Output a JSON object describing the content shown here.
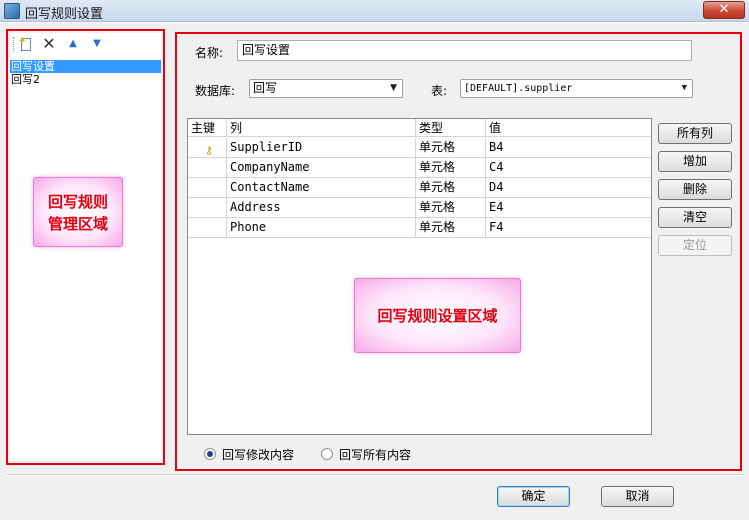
{
  "window": {
    "title": "回写规则设置",
    "close_label": "✕"
  },
  "rules_panel": {
    "toolbar": {
      "new_icon": "new-document-icon",
      "delete_icon": "delete-icon",
      "up_icon": "arrow-up-icon",
      "down_icon": "arrow-down-icon"
    },
    "items": [
      {
        "label": "回写设置",
        "selected": true
      },
      {
        "label": "回写2",
        "selected": false
      }
    ],
    "callout": {
      "line1": "回写规则",
      "line2": "管理区域"
    }
  },
  "settings": {
    "name_label": "名称:",
    "name_value": "回写设置",
    "database_label": "数据库:",
    "database_value": "回写",
    "table_label": "表:",
    "table_value": "[DEFAULT].supplier",
    "grid": {
      "headers": [
        "主键",
        "列",
        "类型",
        "值"
      ],
      "rows": [
        {
          "is_key": true,
          "column": "SupplierID",
          "type": "单元格",
          "value": "B4"
        },
        {
          "is_key": false,
          "column": "CompanyName",
          "type": "单元格",
          "value": "C4"
        },
        {
          "is_key": false,
          "column": "ContactName",
          "type": "单元格",
          "value": "D4"
        },
        {
          "is_key": false,
          "column": "Address",
          "type": "单元格",
          "value": "E4"
        },
        {
          "is_key": false,
          "column": "Phone",
          "type": "单元格",
          "value": "F4"
        }
      ]
    },
    "buttons": {
      "all_columns": "所有列",
      "add": "增加",
      "delete": "删除",
      "clear": "清空",
      "locate": "定位"
    },
    "radio": {
      "modified": "回写修改内容",
      "all": "回写所有内容",
      "selected": "modified"
    },
    "callout": "回写规则设置区域"
  },
  "footer": {
    "ok": "确定",
    "cancel": "取消"
  },
  "colors": {
    "highlight_border": "#e3000f",
    "selection": "#3399ff",
    "callout_text": "#e3000f"
  }
}
